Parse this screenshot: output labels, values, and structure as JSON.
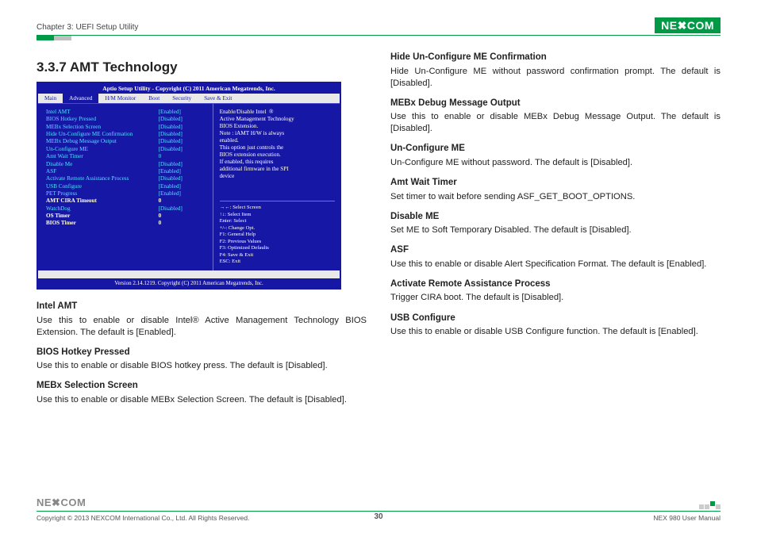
{
  "header": {
    "chapter": "Chapter 3: UEFI Setup Utility",
    "logo_text": "NE✖COM"
  },
  "section_title": "3.3.7  AMT Technology",
  "bios": {
    "titlebar": "Aptio Setup Utility - Copyright (C) 2011 American Megatrends, Inc.",
    "tabs": [
      "Main",
      "Advanced",
      "H/M Monitor",
      "Boot",
      "Security",
      "Save & Exit"
    ],
    "active_tab": "Advanced",
    "settings": [
      {
        "label": "Intel AMT",
        "value": "[Enabled]",
        "style": "cyan"
      },
      {
        "label": "BIOS Hotkey Pressed",
        "value": "[Disabled]",
        "style": "cyan"
      },
      {
        "label": "MEBx Selection Screen",
        "value": "[Disabled]",
        "style": "cyan"
      },
      {
        "label": "Hide Un-Configure ME Confirmation",
        "value": "[Disabled]",
        "style": "cyan"
      },
      {
        "label": "MEBx Debug Message Output",
        "value": "[Disabled]",
        "style": "cyan"
      },
      {
        "label": "Un-Configure ME",
        "value": "[Disabled]",
        "style": "cyan"
      },
      {
        "label": "Amt Wait Timer",
        "value": "0",
        "style": "cyan"
      },
      {
        "label": "Disable Me",
        "value": "[Disabled]",
        "style": "cyan"
      },
      {
        "label": "ASF",
        "value": "[Enabled]",
        "style": "cyan"
      },
      {
        "label": "Activate Remote Assistance Process",
        "value": "[Disabled]",
        "style": "cyan"
      },
      {
        "label": "USB Configure",
        "value": "[Enabled]",
        "style": "cyan"
      },
      {
        "label": "PET Progress",
        "value": "[Enabled]",
        "style": "cyan"
      },
      {
        "label": "AMT CIRA Timeout",
        "value": "0",
        "style": "whitebold"
      },
      {
        "label": "WatchDog",
        "value": "[Disabled]",
        "style": "cyan"
      },
      {
        "label": "  OS Timer",
        "value": "0",
        "style": "whitebold"
      },
      {
        "label": "  BIOS Timer",
        "value": "0",
        "style": "whitebold"
      }
    ],
    "help_lines": [
      "Enable/Disable Intel  ®",
      "Active Management Technology",
      "BIOS Extension.",
      "Note : iAMT H/W is always",
      "enabled.",
      "This option just controls the",
      "BIOS extension execution.",
      "If enabled, this requires",
      "additional firmware in the SPI",
      "device"
    ],
    "help_footer": [
      "→←: Select Screen",
      "↑↓: Select Item",
      "Enter: Select",
      "+/-: Change Opt.",
      "F1: General Help",
      "F2: Previous Values",
      "F3: Optimized Defaults",
      "F4: Save & Exit",
      "ESC: Exit"
    ],
    "version": "Version 2.14.1219. Copyright (C) 2011 American Megatrends, Inc."
  },
  "left_descriptions": [
    {
      "heading": "Intel AMT",
      "body": "Use this to enable or disable Intel® Active Management Technology BIOS Extension. The default is [Enabled]."
    },
    {
      "heading": "BIOS Hotkey Pressed",
      "body": "Use this to enable or disable BIOS hotkey press. The default is [Disabled]."
    },
    {
      "heading": "MEBx Selection Screen",
      "body": "Use this to enable or disable MEBx Selection Screen. The default is [Disabled]."
    }
  ],
  "right_descriptions": [
    {
      "heading": "Hide Un-Configure ME Confirmation",
      "body": "Hide Un-Configure ME without password confirmation prompt. The default is [Disabled]."
    },
    {
      "heading": "MEBx Debug Message Output",
      "body": "Use this to enable or disable MEBx Debug Message Output. The default is [Disabled]."
    },
    {
      "heading": "Un-Configure ME",
      "body": "Un-Configure ME without password. The default is [Disabled]."
    },
    {
      "heading": "Amt Wait Timer",
      "body": "Set timer to wait before sending ASF_GET_BOOT_OPTIONS."
    },
    {
      "heading": "Disable ME",
      "body": "Set ME to Soft Temporary Disabled. The default is [Disabled]."
    },
    {
      "heading": "ASF",
      "body": "Use this to enable or disable Alert Specification Format. The default is [Enabled]."
    },
    {
      "heading": "Activate Remote Assistance Process",
      "body": "Trigger CIRA boot. The default is [Disabled]."
    },
    {
      "heading": "USB Configure",
      "body": "Use this to enable or disable USB Configure function. The default is [Enabled]."
    }
  ],
  "footer": {
    "logo_text": "NE✖COM",
    "copyright": "Copyright © 2013 NEXCOM International Co., Ltd. All Rights Reserved.",
    "page": "30",
    "manual": "NEX 980 User Manual"
  }
}
